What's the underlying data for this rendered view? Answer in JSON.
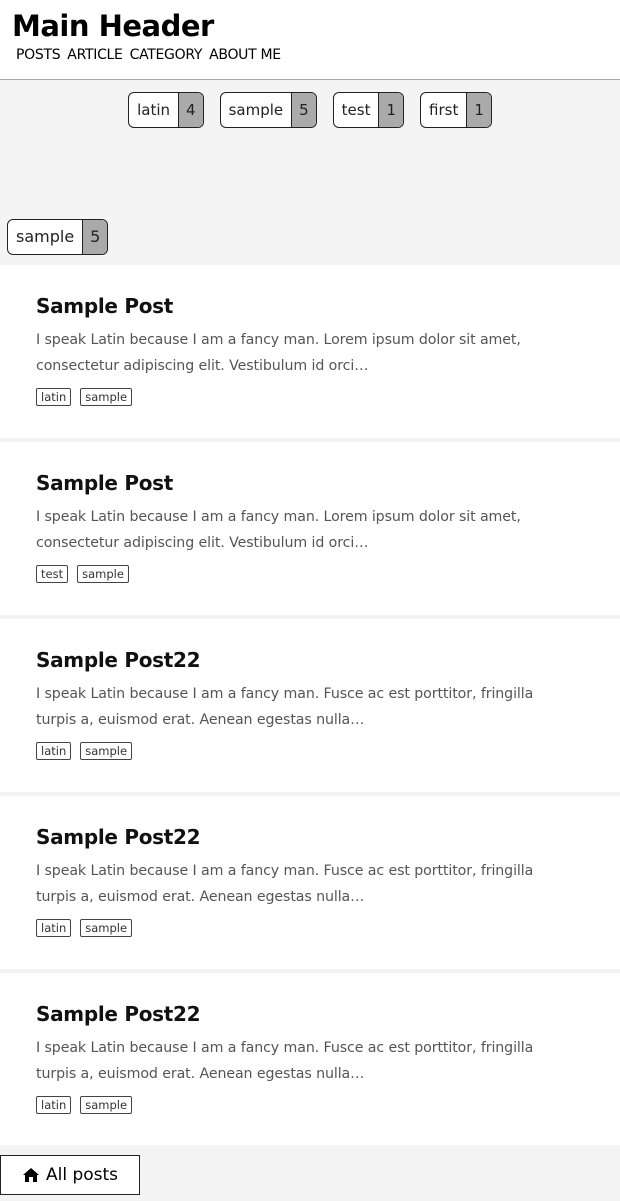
{
  "header": {
    "title": "Main Header",
    "nav": [
      {
        "label": "POSTS"
      },
      {
        "label": "ARTICLE"
      },
      {
        "label": "CATEGORY"
      },
      {
        "label": "ABOUT ME"
      }
    ]
  },
  "tag_cloud": {
    "tags": [
      {
        "name": "latin",
        "count": "4"
      },
      {
        "name": "sample",
        "count": "5"
      },
      {
        "name": "test",
        "count": "1"
      },
      {
        "name": "first",
        "count": "1"
      }
    ],
    "selected": {
      "name": "sample",
      "count": "5"
    }
  },
  "posts": [
    {
      "title": "Sample Post",
      "excerpt": "I speak Latin because I am a fancy man. Lorem ipsum dolor sit amet, consectetur adipiscing elit. Vestibulum id orci…",
      "tags": [
        "latin",
        "sample"
      ]
    },
    {
      "title": "Sample Post",
      "excerpt": "I speak Latin because I am a fancy man. Lorem ipsum dolor sit amet, consectetur adipiscing elit. Vestibulum id orci…",
      "tags": [
        "test",
        "sample"
      ]
    },
    {
      "title": "Sample Post22",
      "excerpt": "I speak Latin because I am a fancy man. Fusce ac est porttitor, fringilla turpis a, euismod erat. Aenean egestas nulla…",
      "tags": [
        "latin",
        "sample"
      ]
    },
    {
      "title": "Sample Post22",
      "excerpt": "I speak Latin because I am a fancy man. Fusce ac est porttitor, fringilla turpis a, euismod erat. Aenean egestas nulla…",
      "tags": [
        "latin",
        "sample"
      ]
    },
    {
      "title": "Sample Post22",
      "excerpt": "I speak Latin because I am a fancy man. Fusce ac est porttitor, fringilla turpis a, euismod erat. Aenean egestas nulla…",
      "tags": [
        "latin",
        "sample"
      ]
    }
  ],
  "footer": {
    "all_posts_label": "All posts",
    "icon": "home-icon"
  },
  "colors": {
    "tag_count_bg": "#aaaaaa",
    "panel_bg": "#f4f4f4",
    "excerpt_text": "#555555"
  }
}
